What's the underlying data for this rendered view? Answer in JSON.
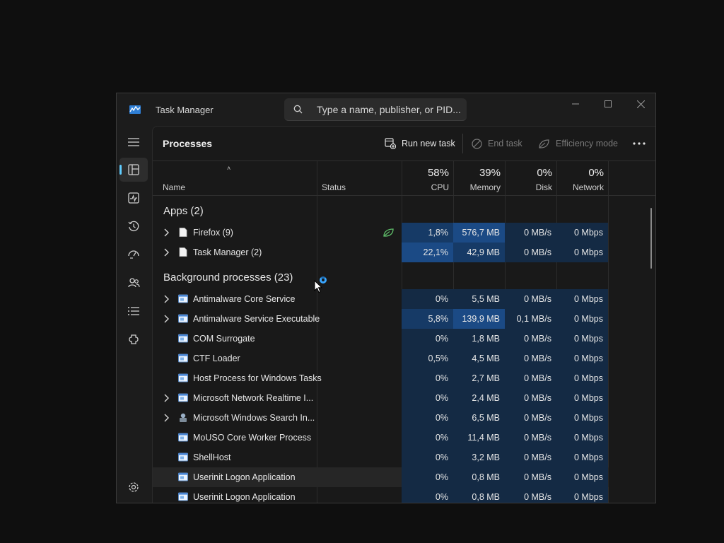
{
  "window": {
    "title": "Task Manager",
    "search_placeholder": "Type a name, publisher, or PID..."
  },
  "sidebar": {
    "items": [
      {
        "name": "menu-icon"
      },
      {
        "name": "processes-icon",
        "active": true
      },
      {
        "name": "performance-icon"
      },
      {
        "name": "app-history-icon"
      },
      {
        "name": "startup-apps-icon"
      },
      {
        "name": "users-icon"
      },
      {
        "name": "details-icon"
      },
      {
        "name": "services-icon"
      },
      {
        "name": "settings-icon"
      }
    ]
  },
  "toolbar": {
    "page_title": "Processes",
    "run_new_task": "Run new task",
    "end_task": "End task",
    "efficiency_mode": "Efficiency mode"
  },
  "columns": {
    "name": "Name",
    "status": "Status",
    "cpu_pct": "58%",
    "cpu": "CPU",
    "memory_pct": "39%",
    "memory": "Memory",
    "disk_pct": "0%",
    "disk": "Disk",
    "network_pct": "0%",
    "network": "Network"
  },
  "groups": {
    "apps": "Apps (2)",
    "background": "Background processes (23)"
  },
  "apps": [
    {
      "name": "Firefox (9)",
      "expandable": true,
      "efficiency_leaf": true,
      "cpu": "1,8%",
      "memory": "576,7 MB",
      "disk": "0 MB/s",
      "network": "0 Mbps"
    },
    {
      "name": "Task Manager (2)",
      "expandable": true,
      "cpu": "22,1%",
      "memory": "42,9 MB",
      "disk": "0 MB/s",
      "network": "0 Mbps"
    }
  ],
  "background": [
    {
      "name": "Antimalware Core Service",
      "expandable": true,
      "cpu": "0%",
      "memory": "5,5 MB",
      "disk": "0 MB/s",
      "network": "0 Mbps"
    },
    {
      "name": "Antimalware Service Executable",
      "expandable": true,
      "cpu": "5,8%",
      "memory": "139,9 MB",
      "disk": "0,1 MB/s",
      "network": "0 Mbps"
    },
    {
      "name": "COM Surrogate",
      "expandable": false,
      "cpu": "0%",
      "memory": "1,8 MB",
      "disk": "0 MB/s",
      "network": "0 Mbps"
    },
    {
      "name": "CTF Loader",
      "expandable": false,
      "cpu": "0,5%",
      "memory": "4,5 MB",
      "disk": "0 MB/s",
      "network": "0 Mbps"
    },
    {
      "name": "Host Process for Windows Tasks",
      "expandable": false,
      "cpu": "0%",
      "memory": "2,7 MB",
      "disk": "0 MB/s",
      "network": "0 Mbps"
    },
    {
      "name": "Microsoft Network Realtime I...",
      "expandable": true,
      "cpu": "0%",
      "memory": "2,4 MB",
      "disk": "0 MB/s",
      "network": "0 Mbps"
    },
    {
      "name": "Microsoft Windows Search In...",
      "expandable": true,
      "special_icon": true,
      "cpu": "0%",
      "memory": "6,5 MB",
      "disk": "0 MB/s",
      "network": "0 Mbps"
    },
    {
      "name": "MoUSO Core Worker Process",
      "expandable": false,
      "cpu": "0%",
      "memory": "11,4 MB",
      "disk": "0 MB/s",
      "network": "0 Mbps"
    },
    {
      "name": "ShellHost",
      "expandable": false,
      "cpu": "0%",
      "memory": "3,2 MB",
      "disk": "0 MB/s",
      "network": "0 Mbps"
    },
    {
      "name": "Userinit Logon Application",
      "expandable": false,
      "hover": true,
      "cpu": "0%",
      "memory": "0,8 MB",
      "disk": "0 MB/s",
      "network": "0 Mbps"
    },
    {
      "name": "Userinit Logon Application",
      "expandable": false,
      "cpu": "0%",
      "memory": "0,8 MB",
      "disk": "0 MB/s",
      "network": "0 Mbps"
    }
  ],
  "colors": {
    "accent": "#60cdff",
    "heat_low": "#142a44",
    "heat_mid": "#163a66",
    "heat_high": "#1b4a85",
    "efficiency_leaf": "#5fbf6a"
  }
}
